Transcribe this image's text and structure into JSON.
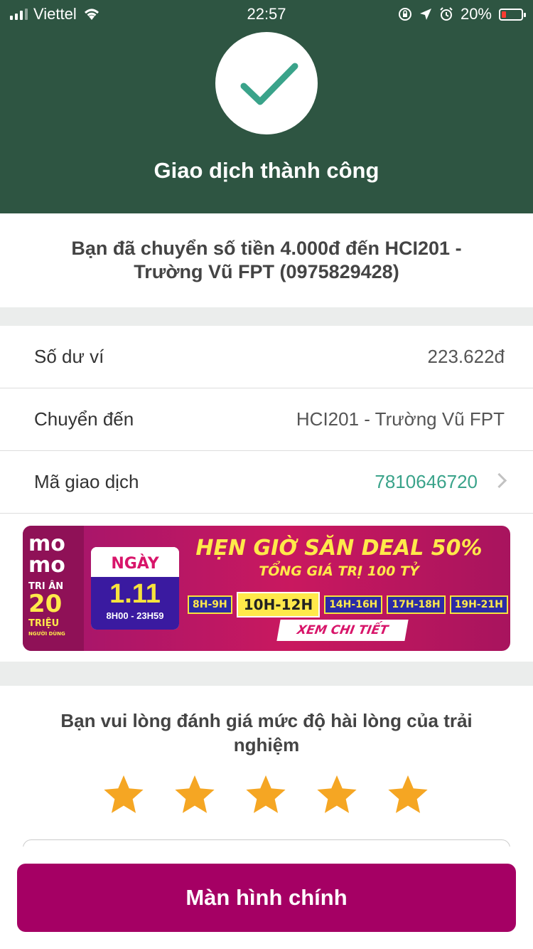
{
  "status_bar": {
    "carrier": "Viettel",
    "time": "22:57",
    "battery": "20%"
  },
  "header": {
    "title": "Giao dịch thành công"
  },
  "message": "Bạn đã chuyển số tiền 4.000đ đến HCI201 - Trường Vũ FPT (0975829428)",
  "details": [
    {
      "label": "Số dư ví",
      "value": "223.622đ"
    },
    {
      "label": "Chuyển đến",
      "value": "HCI201 - Trường Vũ FPT"
    },
    {
      "label": "Mã giao dịch",
      "value": "7810646720"
    }
  ],
  "banner": {
    "brand_top": "mo",
    "brand_bottom": "mo",
    "tri_an": "TRI ÂN",
    "twenty": "20",
    "trieu": "TRIỆU",
    "nguoi_dung": "NGƯỜI DÙNG",
    "day_label": "NGÀY",
    "date": "1.11",
    "hours": "8H00 - 23H59",
    "title": "HẸN GIỜ SĂN DEAL 50%",
    "subtitle": "TỔNG GIÁ TRỊ 100 TỶ",
    "slots": [
      "8H-9H",
      "10H-12H",
      "14H-16H",
      "17H-18H",
      "19H-21H"
    ],
    "cta": "XEM CHI TIẾT"
  },
  "rating": {
    "question": "Bạn vui lòng đánh giá mức độ hài lòng của trải nghiệm",
    "stars": 5
  },
  "main_button": "Màn hình chính",
  "colors": {
    "header": "#2e5542",
    "accent": "#a50064",
    "link": "#3aa38a",
    "star": "#f5a623"
  }
}
